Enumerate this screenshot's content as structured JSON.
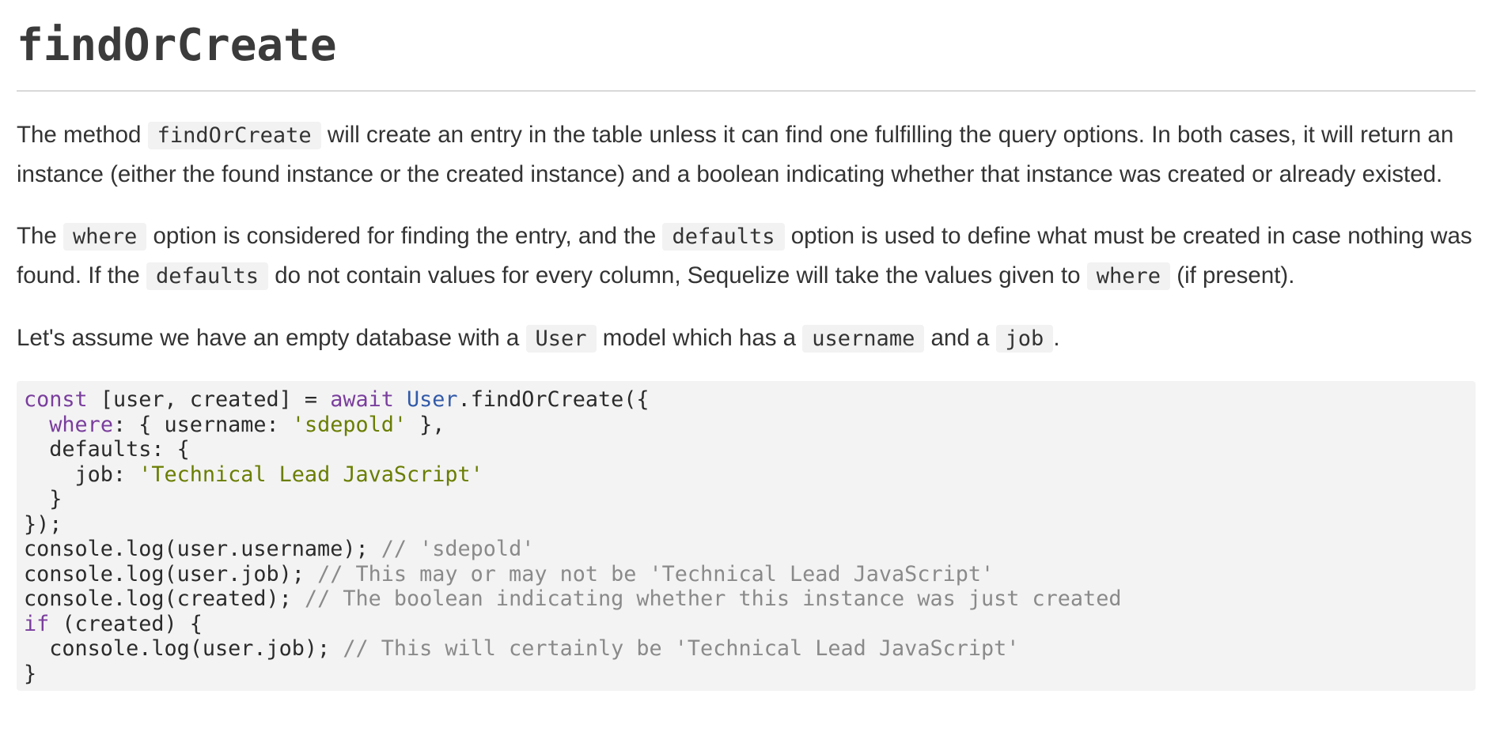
{
  "heading": "findOrCreate",
  "intro": {
    "t1": "The method ",
    "c1": "findOrCreate",
    "t2": " will create an entry in the table unless it can find one fulfilling the query options. In both cases, it will return an instance (either the found instance or the created instance) and a boolean indicating whether that instance was created or already existed."
  },
  "options": {
    "t1": "The ",
    "c1": "where",
    "t2": " option is considered for finding the entry, and the ",
    "c2": "defaults",
    "t3": " option is used to define what must be created in case nothing was found. If the ",
    "c3": "defaults",
    "t4": " do not contain values for every column, Sequelize will take the values given to ",
    "c4": "where",
    "t5": " (if present)."
  },
  "assume": {
    "t1": "Let's assume we have an empty database with a ",
    "c1": "User",
    "t2": " model which has a ",
    "c2": "username",
    "t3": " and a ",
    "c3": "job",
    "t4": "."
  },
  "code": {
    "l1": {
      "kw_const": "const",
      "a": " [user, created] = ",
      "kw_await": "await",
      "sp": " ",
      "cls": "User",
      "b": ".findOrCreate({"
    },
    "l2": {
      "indent": "  ",
      "prop": "where",
      "a": ": { username: ",
      "str": "'sdepold'",
      "b": " },"
    },
    "l3": {
      "text": "  defaults: {"
    },
    "l4": {
      "a": "    job: ",
      "str": "'Technical Lead JavaScript'"
    },
    "l5": {
      "text": "  }"
    },
    "l6": {
      "text": "});"
    },
    "l7": {
      "a": "console.log(user.username); ",
      "cmt": "// 'sdepold'"
    },
    "l8": {
      "a": "console.log(user.job); ",
      "cmt": "// This may or may not be 'Technical Lead JavaScript'"
    },
    "l9": {
      "a": "console.log(created); ",
      "cmt": "// The boolean indicating whether this instance was just created"
    },
    "l10": {
      "kw": "if",
      "a": " (created) {"
    },
    "l11": {
      "a": "  console.log(user.job); ",
      "cmt": "// This will certainly be 'Technical Lead JavaScript'"
    },
    "l12": {
      "text": "}"
    }
  }
}
